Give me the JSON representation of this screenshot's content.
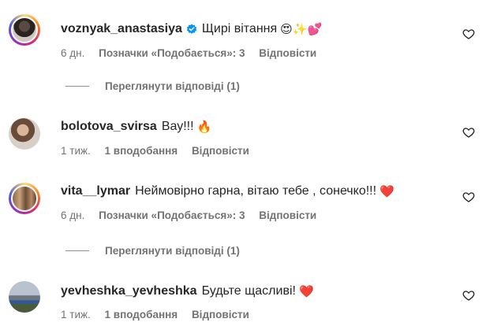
{
  "comments": [
    {
      "username": "voznyak_anastasiya",
      "verified": true,
      "text": "Щирі вітання",
      "emoji": "😍✨💕",
      "time": "6 дн.",
      "likes": "Позначки «Подобається»: 3",
      "reply": "Відповісти",
      "view_replies": "Переглянути відповіді (1)"
    },
    {
      "username": "bolotova_svirsa",
      "text": "Вау!!!",
      "emoji": "🔥",
      "time": "1 тиж.",
      "likes": "1 вподобання",
      "reply": "Відповісти"
    },
    {
      "username": "vita__lymar",
      "text": "Неймовірно гарна, вітаю тебе , сонечко!!!",
      "emoji": "❤️",
      "time": "6 дн.",
      "likes": "Позначки «Подобається»: 3",
      "reply": "Відповісти",
      "view_replies": "Переглянути відповіді (1)"
    },
    {
      "username": "yevheshka_yevheshka",
      "text": "Будьте щасливі!",
      "emoji": "❤️",
      "time": "1 тиж.",
      "likes": "1 вподобання",
      "reply": "Відповісти"
    }
  ],
  "colors": {
    "text": "#262626",
    "secondary": "#737373",
    "verified": "#0095f6"
  },
  "icons": {
    "like": "heart-outline-icon",
    "verified": "verified-badge-icon"
  }
}
